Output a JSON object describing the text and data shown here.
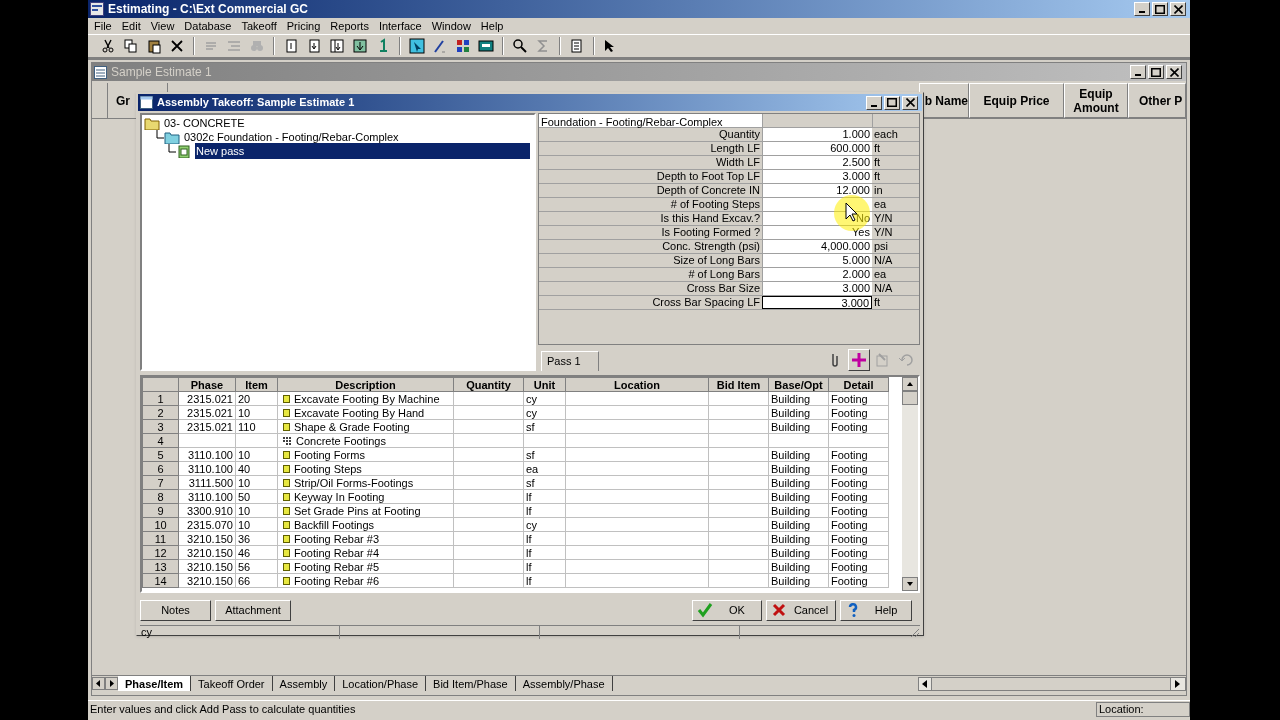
{
  "app": {
    "title": "Estimating - C:\\Ext Commercial GC",
    "menu": [
      "File",
      "Edit",
      "View",
      "Database",
      "Takeoff",
      "Pricing",
      "Reports",
      "Interface",
      "Window",
      "Help"
    ]
  },
  "estimate_window": {
    "title": "Sample Estimate 1",
    "left_column": "Gr",
    "right_columns": [
      "b Name",
      "Equip Price",
      "Equip Amount",
      "Other P"
    ]
  },
  "dialog": {
    "title": "Assembly Takeoff:  Sample Estimate 1",
    "tree": [
      {
        "label": "03- CONCRETE",
        "selected": false,
        "children": [
          {
            "label": "0302c  Foundation - Footing/Rebar-Complex",
            "selected": false,
            "children": [
              {
                "label": "New pass",
                "selected": true
              }
            ]
          }
        ]
      }
    ],
    "properties": {
      "title": "Foundation - Footing/Rebar-Complex",
      "rows": [
        {
          "label": "Quantity",
          "value": "1.000",
          "unit": "each",
          "focused": false
        },
        {
          "label": "Length LF",
          "value": "600.000",
          "unit": "ft",
          "focused": false
        },
        {
          "label": "Width LF",
          "value": "2.500",
          "unit": "ft",
          "focused": false
        },
        {
          "label": "Depth to Foot Top LF",
          "value": "3.000",
          "unit": "ft",
          "focused": false
        },
        {
          "label": "Depth of Concrete IN",
          "value": "12.000",
          "unit": "in",
          "focused": false
        },
        {
          "label": "# of Footing Steps",
          "unit": "ea",
          "focused": false
        },
        {
          "label": "Is this Hand Excav.?",
          "value": "No",
          "unit": "Y/N",
          "focused": false
        },
        {
          "label": "Is Footing Formed ?",
          "value": "Yes",
          "unit": "Y/N",
          "focused": false
        },
        {
          "label": "Conc. Strength (psi)",
          "value": "4,000.000",
          "unit": "psi",
          "focused": false
        },
        {
          "label": "Size of  Long  Bars",
          "value": "5.000",
          "unit": "N/A",
          "focused": false
        },
        {
          "label": "# of Long Bars",
          "value": "2.000",
          "unit": "ea",
          "focused": false
        },
        {
          "label": "Cross Bar Size",
          "value": "3.000",
          "unit": "N/A",
          "focused": false
        },
        {
          "label": "Cross Bar Spacing LF",
          "value": "3.000",
          "unit": "ft",
          "focused": true
        }
      ]
    },
    "pass_tab": "Pass 1",
    "grid": {
      "columns": [
        "Phase",
        "Item",
        "Description",
        "Quantity",
        "Unit",
        "Location",
        "Bid Item",
        "Base/Opt",
        "Detail"
      ],
      "rows": [
        {
          "number": "1",
          "kind": "item",
          "phase": "2315.021",
          "item": "20",
          "description": "Excavate Footing By Machine",
          "unit": "cy",
          "base_opt": "Building",
          "detail": "Footing"
        },
        {
          "number": "2",
          "kind": "item",
          "phase": "2315.021",
          "item": "10",
          "description": "Excavate Footing By Hand",
          "unit": "cy",
          "base_opt": "Building",
          "detail": "Footing"
        },
        {
          "number": "3",
          "kind": "item",
          "phase": "2315.021",
          "item": "110",
          "description": "Shape & Grade Footing",
          "unit": "sf",
          "base_opt": "Building",
          "detail": "Footing"
        },
        {
          "number": "4",
          "kind": "group",
          "description": "Concrete Footings"
        },
        {
          "number": "5",
          "kind": "item",
          "phase": "3110.100",
          "item": "10",
          "description": "Footing Forms",
          "unit": "sf",
          "base_opt": "Building",
          "detail": "Footing"
        },
        {
          "number": "6",
          "kind": "item",
          "phase": "3110.100",
          "item": "40",
          "description": "Footing Steps",
          "unit": "ea",
          "base_opt": "Building",
          "detail": "Footing"
        },
        {
          "number": "7",
          "kind": "item",
          "phase": "3111.500",
          "item": "10",
          "description": "Strip/Oil Forms-Footings",
          "unit": "sf",
          "base_opt": "Building",
          "detail": "Footing"
        },
        {
          "number": "8",
          "kind": "item",
          "phase": "3110.100",
          "item": "50",
          "description": "Keyway In Footing",
          "unit": "lf",
          "base_opt": "Building",
          "detail": "Footing"
        },
        {
          "number": "9",
          "kind": "item",
          "phase": "3300.910",
          "item": "10",
          "description": "Set Grade Pins at Footing",
          "unit": "lf",
          "base_opt": "Building",
          "detail": "Footing"
        },
        {
          "number": "10",
          "kind": "item",
          "phase": "2315.070",
          "item": "10",
          "description": "Backfill Footings",
          "unit": "cy",
          "base_opt": "Building",
          "detail": "Footing"
        },
        {
          "number": "11",
          "kind": "item",
          "phase": "3210.150",
          "item": "36",
          "description": "Footing Rebar #3",
          "unit": "lf",
          "base_opt": "Building",
          "detail": "Footing"
        },
        {
          "number": "12",
          "kind": "item",
          "phase": "3210.150",
          "item": "46",
          "description": "Footing Rebar #4",
          "unit": "lf",
          "base_opt": "Building",
          "detail": "Footing"
        },
        {
          "number": "13",
          "kind": "item",
          "phase": "3210.150",
          "item": "56",
          "description": "Footing Rebar #5",
          "unit": "lf",
          "base_opt": "Building",
          "detail": "Footing"
        },
        {
          "number": "14",
          "kind": "item",
          "phase": "3210.150",
          "item": "66",
          "description": "Footing Rebar #6",
          "unit": "lf",
          "base_opt": "Building",
          "detail": "Footing"
        }
      ]
    },
    "buttons": [
      {
        "label": "Notes",
        "kind": "plain"
      },
      {
        "label": "Attachment",
        "kind": "plain"
      },
      {
        "label": "OK",
        "kind": "ok"
      },
      {
        "label": "Cancel",
        "kind": "cancel"
      },
      {
        "label": "Help",
        "kind": "help"
      }
    ],
    "status": "cy"
  },
  "sheet_tabs": [
    {
      "label": "Phase/Item",
      "selected": true
    },
    {
      "label": "Takeoff Order",
      "selected": false
    },
    {
      "label": "Assembly",
      "selected": false
    },
    {
      "label": "Location/Phase",
      "selected": false
    },
    {
      "label": "Bid Item/Phase",
      "selected": false
    },
    {
      "label": "Assembly/Phase",
      "selected": false
    }
  ],
  "status_bar": {
    "message": "Enter values and click Add Pass to calculate quantities",
    "location_label": "Location:"
  }
}
